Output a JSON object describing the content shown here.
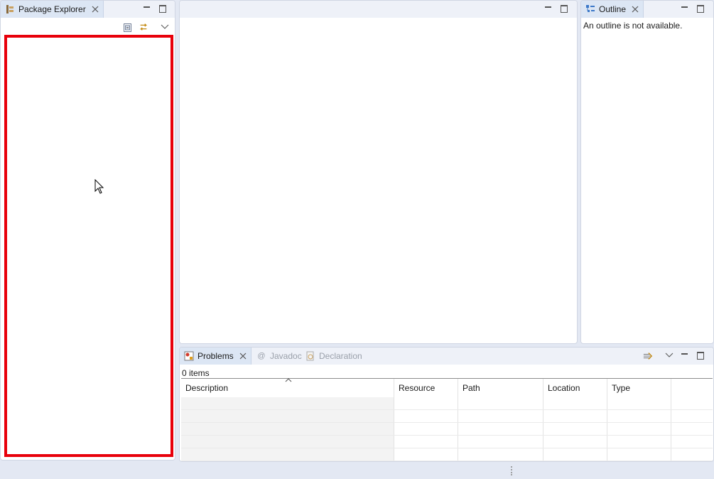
{
  "package_explorer": {
    "tab_label": "Package Explorer",
    "icon": "package-explorer-icon"
  },
  "outline": {
    "tab_label": "Outline",
    "message": "An outline is not available."
  },
  "problems": {
    "tabs": [
      {
        "label": "Problems",
        "icon": "problems-icon",
        "active": true
      },
      {
        "label": "Javadoc",
        "icon": "javadoc-icon",
        "active": false
      },
      {
        "label": "Declaration",
        "icon": "declaration-icon",
        "active": false
      }
    ],
    "items_count": "0 items",
    "columns": [
      "Description",
      "Resource",
      "Path",
      "Location",
      "Type"
    ]
  },
  "colors": {
    "highlight": "#e8000b",
    "workbench_bg": "#e3e8f3",
    "active_tab": "#dce6f4"
  }
}
